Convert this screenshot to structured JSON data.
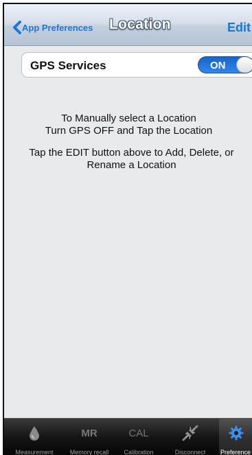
{
  "navbar": {
    "back_label": "App Preferences",
    "title": "Location",
    "edit_label": "Edit"
  },
  "gps": {
    "label": "GPS Services",
    "toggle_state": "ON"
  },
  "info": {
    "line1": "To Manually select a Location",
    "line2": "Turn GPS OFF and Tap the Location",
    "line3": "Tap the EDIT button above to Add, Delete, or",
    "line4": "Rename a Location"
  },
  "tabs": [
    {
      "label": "Measurement",
      "icon": "drop-icon"
    },
    {
      "label": "Memory recall",
      "icon": "MR"
    },
    {
      "label": "Calibration",
      "icon": "CAL"
    },
    {
      "label": "Disconnect",
      "icon": "disconnect-icon"
    },
    {
      "label": "Preference",
      "icon": "gear-icon"
    }
  ],
  "colors": {
    "accent": "#1f74d8",
    "toggle": "#2a7be6",
    "tabbar": "#111111",
    "gear": "#3b8fe8"
  }
}
